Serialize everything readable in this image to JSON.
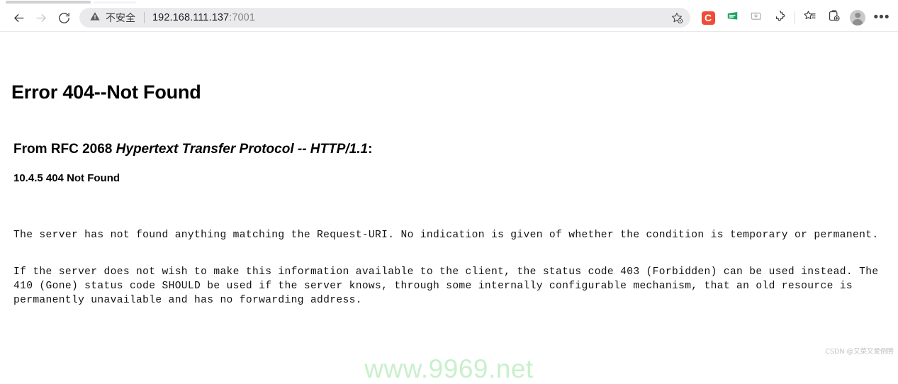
{
  "browser": {
    "nav": {
      "back_label": "Back",
      "forward_label": "Forward",
      "reload_label": "Refresh"
    },
    "omnibox": {
      "security_text": "不安全",
      "security_icon": "warning-triangle-icon",
      "url_host": "192.168.111.137",
      "url_port": ":7001",
      "add_favorite_label": "Add this page to favorites"
    },
    "toolbar_icons": [
      {
        "name": "extension-c",
        "label": "C",
        "color": "#f04b35"
      },
      {
        "name": "extension-green-doc",
        "label": "Green extension"
      },
      {
        "name": "collections-download-icon",
        "label": "Downloads"
      },
      {
        "name": "extensions-puzzle-icon",
        "label": "Extensions"
      },
      {
        "name": "favorites-list-icon",
        "label": "Favorites"
      },
      {
        "name": "collections-add-icon",
        "label": "Collections"
      },
      {
        "name": "profile-avatar",
        "label": "Profile"
      },
      {
        "name": "more-menu-icon",
        "label": "Settings and more"
      }
    ]
  },
  "page": {
    "error_title": "Error 404--Not Found",
    "rfc_prefix": "From RFC 2068 ",
    "rfc_italic": "Hypertext Transfer Protocol -- HTTP/1.1",
    "rfc_suffix": ":",
    "section_heading": "10.4.5 404 Not Found",
    "paragraph_1": "The server has not found anything matching the Request-URI. No indication is given of whether the condition is temporary or permanent.",
    "paragraph_2": "If the server does not wish to make this information available to the client, the status code 403 (Forbidden) can be used instead. The 410 (Gone) status code SHOULD be used if the server knows, through some internally configurable mechanism, that an old resource is permanently unavailable and has no forwarding address.",
    "watermark_site": "www.9969.net",
    "watermark_site_color": "#c8f0cc",
    "watermark_csdn": "CSDN @又菜又爱倒腾"
  }
}
